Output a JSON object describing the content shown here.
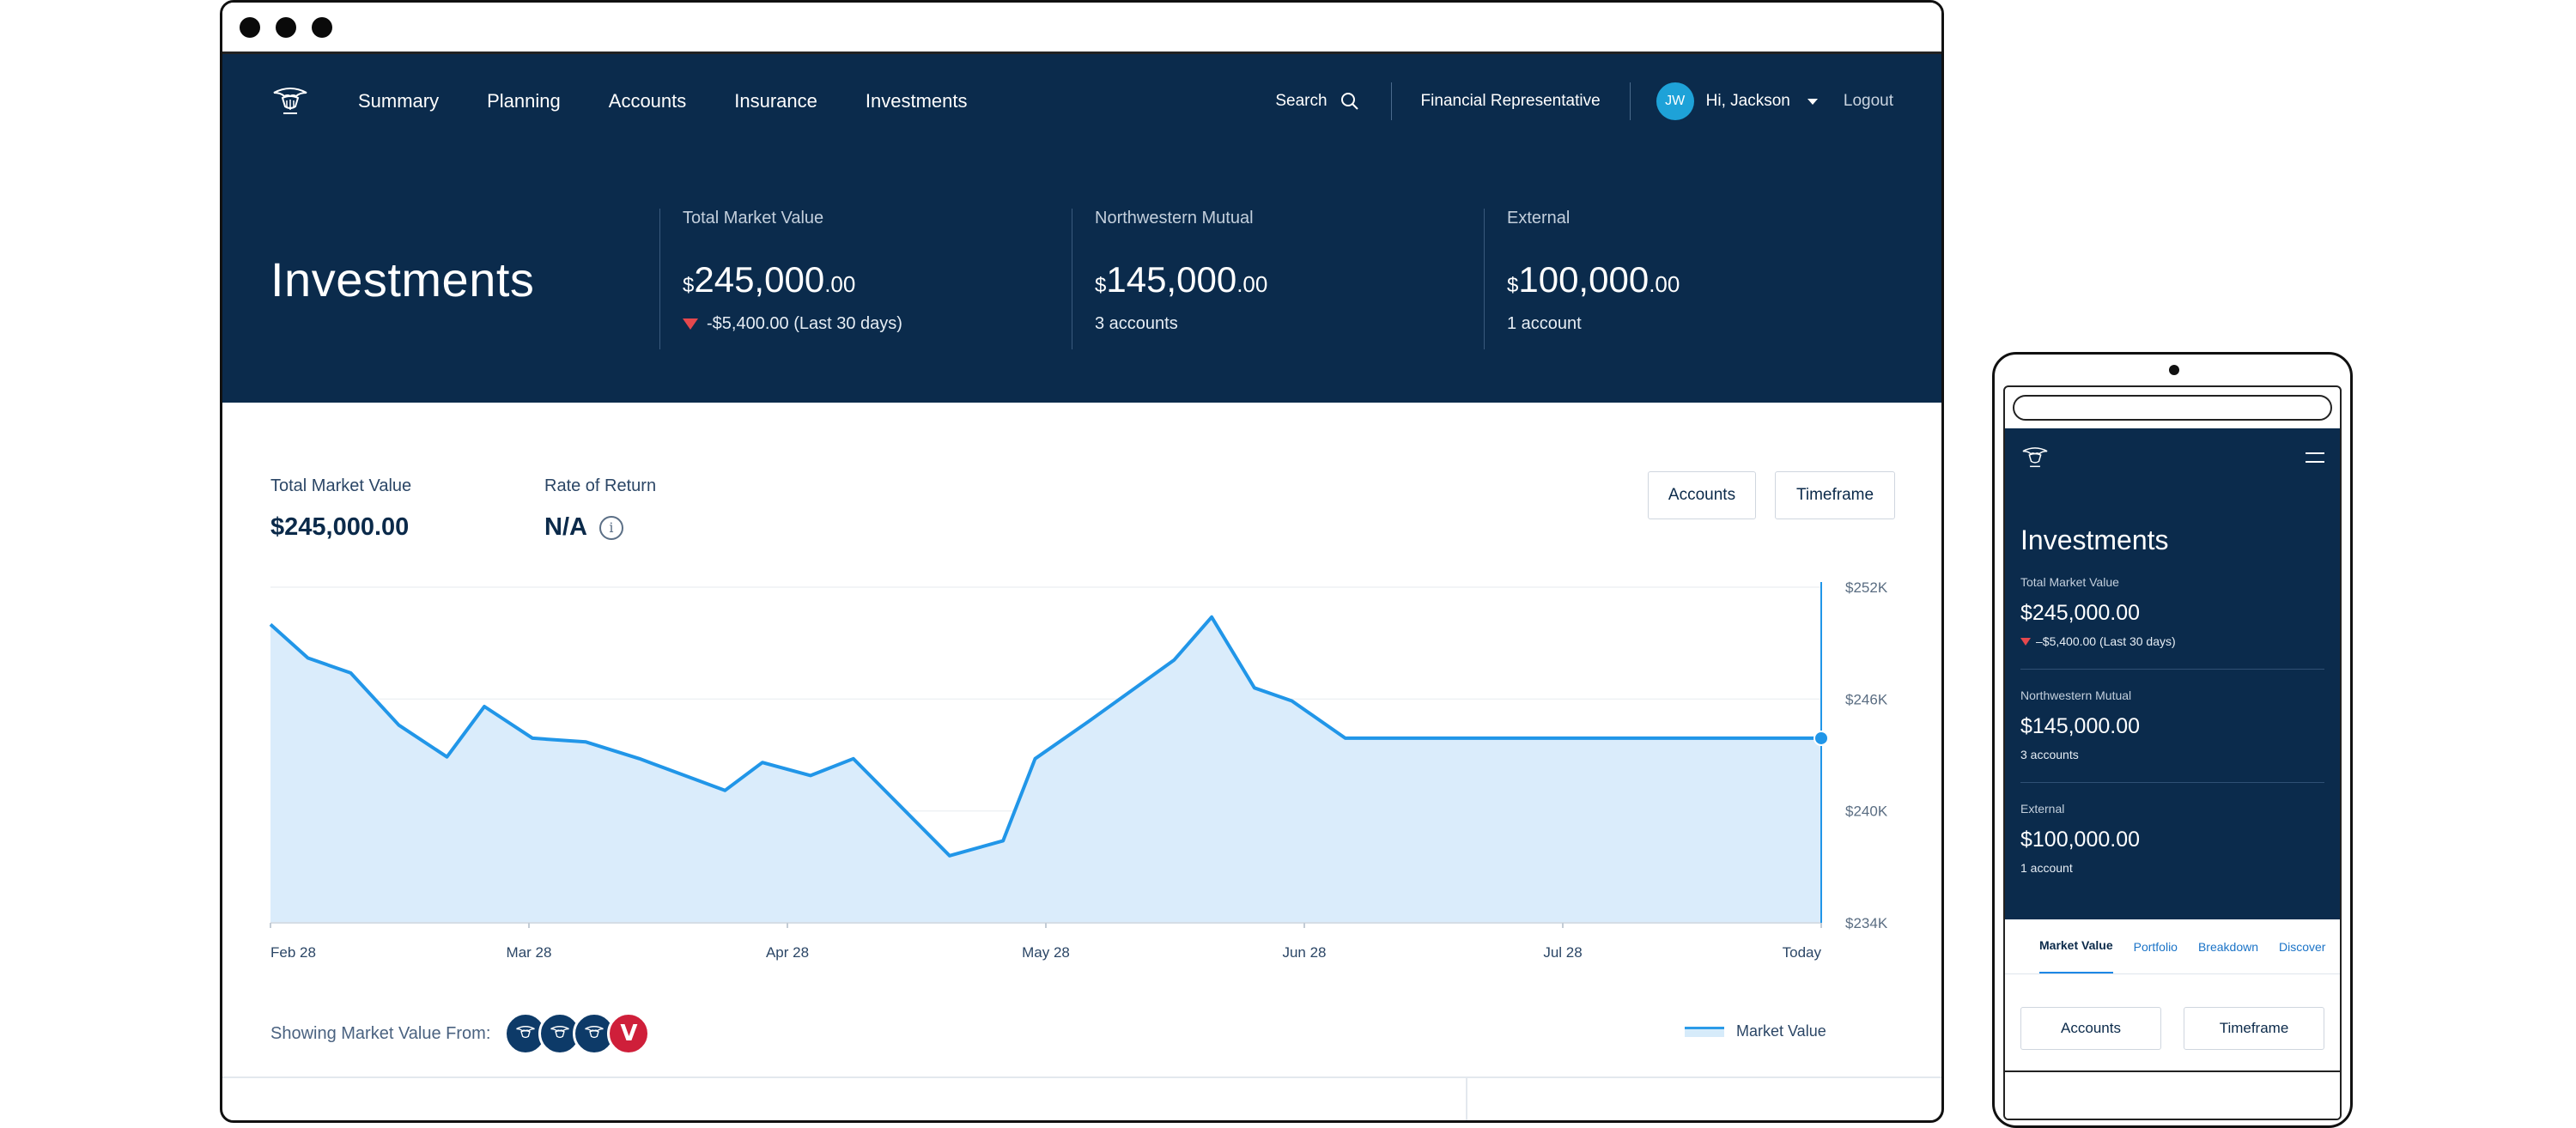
{
  "nav": {
    "items": [
      "Summary",
      "Planning",
      "Accounts",
      "Insurance",
      "Investments"
    ],
    "search_label": "Search",
    "rep_label": "Financial Representative",
    "avatar_initials": "JW",
    "greeting": "Hi, Jackson",
    "logout": "Logout"
  },
  "hero": {
    "title": "Investments",
    "cards": [
      {
        "label": "Total Market Value",
        "currency": "$",
        "amount": "245,000",
        "cents": ".00",
        "sub": "-$5,400.00 (Last 30 days)"
      },
      {
        "label": "Northwestern Mutual",
        "currency": "$",
        "amount": "145,000",
        "cents": ".00",
        "sub": "3 accounts"
      },
      {
        "label": "External",
        "currency": "$",
        "amount": "100,000",
        "cents": ".00",
        "sub": "1 account"
      }
    ]
  },
  "summary": {
    "tmv_label": "Total Market Value",
    "tmv_value": "$245,000.00",
    "ror_label": "Rate of Return",
    "ror_value": "N/A",
    "accounts_button": "Accounts",
    "timeframe_button": "Timeframe"
  },
  "chart_data": {
    "type": "area",
    "y_ticks": [
      "$252K",
      "$246K",
      "$240K",
      "$234K"
    ],
    "ylim": [
      234,
      252
    ],
    "x_ticks": [
      "Feb 28",
      "Mar 28",
      "Apr 28",
      "May 28",
      "Jun 28",
      "Jul 28",
      "Today"
    ],
    "series": [
      {
        "name": "Market Value",
        "x": [
          0,
          0.35,
          0.75,
          1.2,
          1.65,
          2.0,
          2.45,
          2.95,
          3.45,
          4.25,
          4.6,
          5.05,
          5.45,
          6.35,
          6.85,
          7.15,
          7.65,
          8.45,
          8.8,
          9.2,
          9.55,
          10.05,
          10.55,
          11.15,
          11.65,
          12.45,
          12.95,
          13.45,
          13.7,
          14.25,
          14.5
        ],
        "values": [
          250.0,
          248.2,
          247.4,
          244.6,
          242.9,
          245.6,
          243.9,
          243.7,
          242.8,
          241.1,
          242.6,
          241.9,
          242.8,
          237.6,
          238.4,
          242.8,
          244.8,
          248.1,
          250.4,
          246.6,
          245.9,
          243.9,
          243.9,
          243.9,
          243.9,
          243.9,
          243.9,
          243.9,
          243.9,
          243.9,
          243.9
        ]
      }
    ],
    "legend": "Market Value"
  },
  "showing": {
    "label": "Showing Market Value From:",
    "badge_v": "V"
  },
  "mobile": {
    "title": "Investments",
    "blocks": [
      {
        "label": "Total Market Value",
        "value": "$245,000.00",
        "sub": "–$5,400.00 (Last 30 days)"
      },
      {
        "label": "Northwestern Mutual",
        "value": "$145,000.00",
        "sub": "3 accounts"
      },
      {
        "label": "External",
        "value": "$100,000.00",
        "sub": "1 account"
      }
    ],
    "tabs": [
      "Market Value",
      "Portfolio",
      "Breakdown",
      "Discover"
    ],
    "accounts_button": "Accounts",
    "timeframe_button": "Timeframe"
  }
}
